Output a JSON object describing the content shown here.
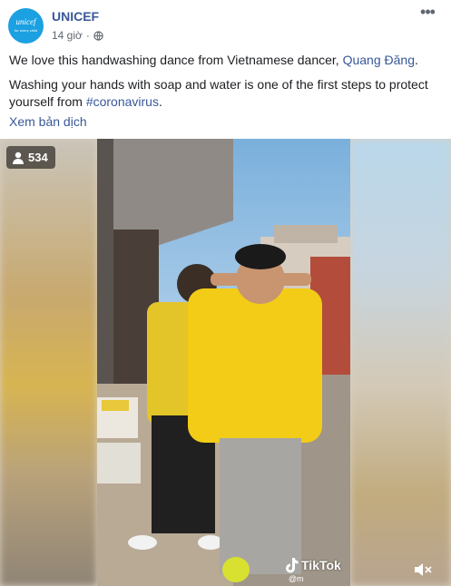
{
  "post": {
    "page_name": "UNICEF",
    "timestamp": "14 giờ",
    "separator": "·",
    "avatar": {
      "logo": "unicef",
      "tagline": "for every child"
    },
    "more_label": "•••",
    "text": {
      "line1_prefix": "We love this handwashing dance from Vietnamese dancer, ",
      "line1_link": "Quang Đăng",
      "line1_suffix": ".",
      "line2_prefix": "Washing your hands with soap and water is one of the first steps to protect yourself from ",
      "line2_hashtag": "#coronavirus",
      "line2_suffix": "."
    },
    "see_translation": "Xem bản dịch"
  },
  "video": {
    "viewer_count": "534",
    "watermark": "TikTok",
    "watermark_handle": "@m",
    "icons": [
      "person-icon",
      "tiktok-note-icon",
      "volume-muted-icon",
      "globe-icon"
    ]
  },
  "colors": {
    "link": "#385898",
    "meta_text": "#606770",
    "unicef_blue": "#1ba0e2",
    "jacket_yellow": "#f2cc17"
  }
}
